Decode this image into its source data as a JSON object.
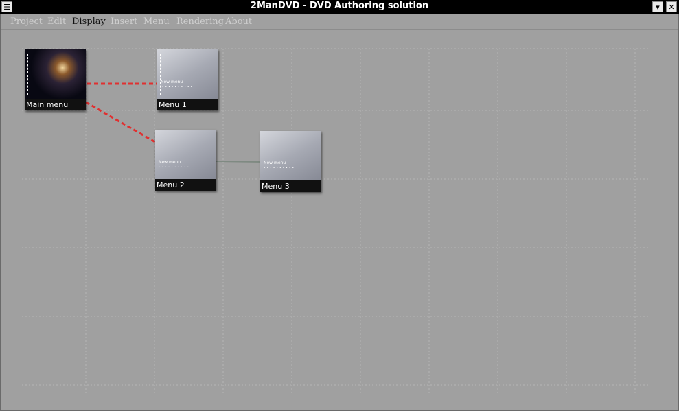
{
  "window": {
    "title": "2ManDVD - DVD Authoring solution"
  },
  "titlebar": {
    "menu_glyph": "☰",
    "minimize_glyph": "▾",
    "close_glyph": "✕"
  },
  "menubar": {
    "items": [
      {
        "label": "Project",
        "active": false
      },
      {
        "label": "Edit",
        "active": false
      },
      {
        "label": "Display",
        "active": true
      },
      {
        "label": "Insert",
        "active": false
      },
      {
        "label": "Menu",
        "active": false
      },
      {
        "label": "Rendering",
        "active": false
      },
      {
        "label": "About",
        "active": false
      }
    ]
  },
  "nodes": [
    {
      "label": "Main menu",
      "style": "dark"
    },
    {
      "label": "Menu 1",
      "style": "gray",
      "thumb_title": "New menu"
    },
    {
      "label": "Menu 2",
      "style": "gray",
      "thumb_title": "New menu"
    },
    {
      "label": "Menu 3",
      "style": "gray",
      "thumb_title": "New menu"
    }
  ],
  "colors": {
    "link_dashed": "#e03030",
    "link_solid": "#7f8a82",
    "grid": "#b6b6b6",
    "canvas_bg": "#a0a0a0"
  }
}
